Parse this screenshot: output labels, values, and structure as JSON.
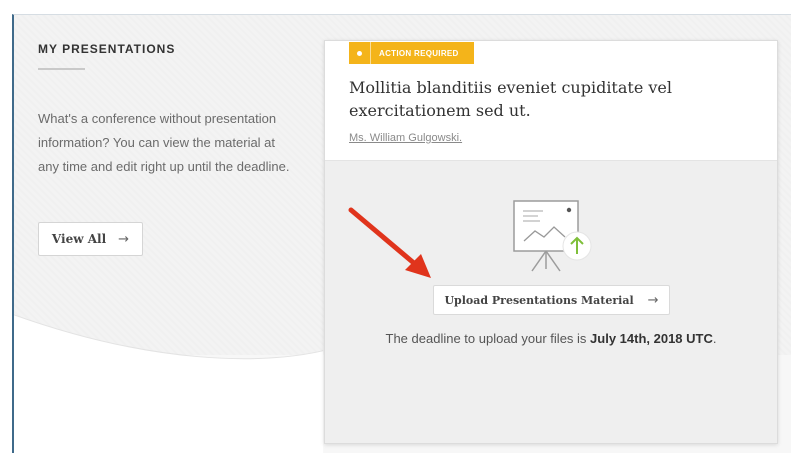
{
  "section": {
    "title": "MY PRESENTATIONS",
    "description": "What's a conference without presentation information? You can view the material at any time and edit right up until the deadline.",
    "view_all_label": "View All",
    "view_all_arrow": "→"
  },
  "card": {
    "badge_label": "ACTION REQUIRED",
    "title": "Mollitia blanditiis eveniet cupiditate vel exercitationem sed ut.",
    "presenter": "Ms. William Gulgowski.",
    "upload_label": "Upload Presentations Material",
    "upload_arrow": "→",
    "deadline_prefix": "The deadline to upload your files is ",
    "deadline_date": "July 14th, 2018 UTC",
    "deadline_suffix": "."
  },
  "colors": {
    "badge": "#f4b41a",
    "annotation_arrow": "#e0341c",
    "upload_accent": "#7fbf3a",
    "frame_border": "#3f6a8a"
  },
  "icons": {
    "presentation": "presentation-board-icon",
    "upload": "upload-arrow-icon",
    "annotation": "red-pointer-arrow"
  }
}
